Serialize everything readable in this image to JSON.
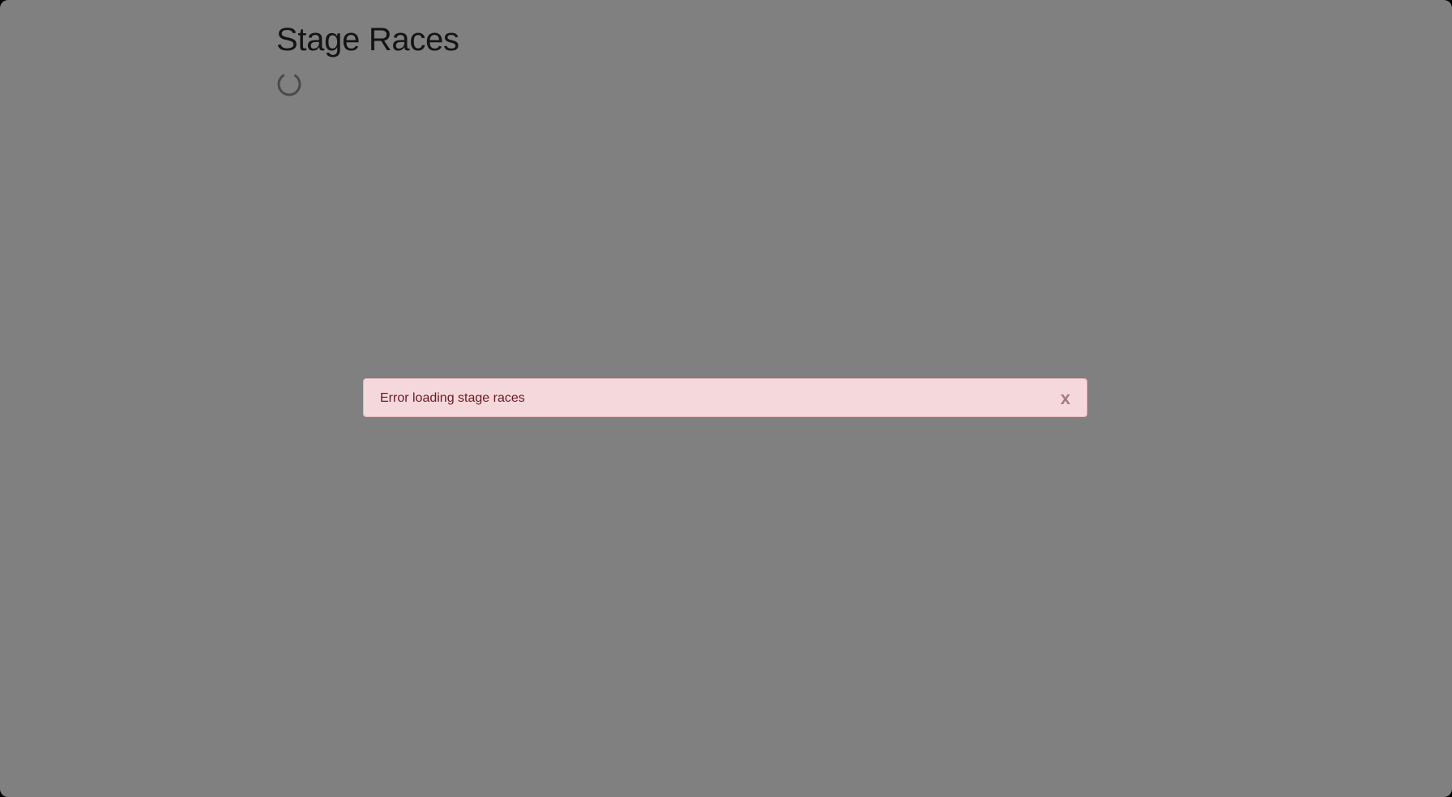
{
  "page": {
    "title": "Stage Races"
  },
  "loading": {
    "icon": "loading-spinner-icon",
    "state": "loading"
  },
  "alert": {
    "type": "error",
    "message": "Error loading stage races",
    "close_label": "x",
    "close_icon": "close-icon"
  },
  "colors": {
    "overlay": "#808080",
    "title": "#141414",
    "alert_background": "#f4d8dc",
    "alert_border": "#e7b8bf",
    "alert_text": "#6a1a21",
    "alert_close": "#a87a80"
  }
}
